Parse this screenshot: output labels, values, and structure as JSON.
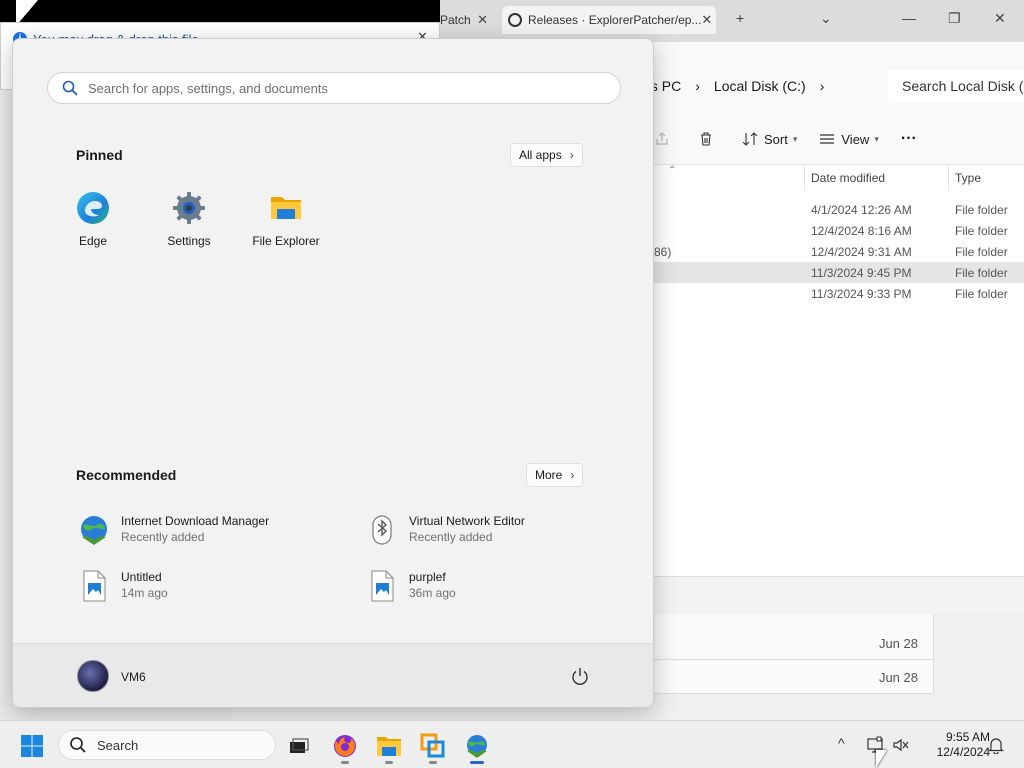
{
  "browser": {
    "tab_partial": "Patch",
    "tab_active": "Releases · ExplorerPatcher/ep...",
    "tab_close": "✕",
    "new_tab": "+",
    "dropdown": "⌄",
    "minimize": "—",
    "maximize": "❐",
    "close": "✕"
  },
  "banner": {
    "text": "You may drag & drop this file",
    "close": "✕"
  },
  "explorer": {
    "breadcrumb": [
      "his PC",
      "›",
      "Local Disk (C:)",
      "›"
    ],
    "search_placeholder": "Search Local Disk (C:)",
    "toolbar": {
      "sort": "Sort",
      "view": "View",
      "more": "···"
    },
    "columns": [
      "Date modified",
      "Type"
    ],
    "rows": [
      {
        "name": "",
        "date": "4/1/2024 12:26 AM",
        "type": "File folder",
        "selected": false
      },
      {
        "name": "",
        "date": "12/4/2024 8:16 AM",
        "type": "File folder",
        "selected": false
      },
      {
        "name": "86)",
        "date": "12/4/2024 9:31 AM",
        "type": "File folder",
        "selected": false
      },
      {
        "name": "",
        "date": "11/3/2024 9:45 PM",
        "type": "File folder",
        "selected": true
      },
      {
        "name": "",
        "date": "11/3/2024 9:33 PM",
        "type": "File folder",
        "selected": false
      }
    ]
  },
  "lower_list": [
    "Jun 28",
    "Jun 28"
  ],
  "start_menu": {
    "search_placeholder": "Search for apps, settings, and documents",
    "pinned_title": "Pinned",
    "all_apps": "All apps",
    "arrow": "›",
    "pinned": [
      {
        "label": "Edge",
        "icon": "edge-icon"
      },
      {
        "label": "Settings",
        "icon": "settings-gear-icon"
      },
      {
        "label": "File Explorer",
        "icon": "folder-icon"
      }
    ],
    "recommended_title": "Recommended",
    "more": "More",
    "recommended": [
      {
        "name": "Internet Download Manager",
        "sub": "Recently added",
        "icon": "idm-globe-icon"
      },
      {
        "name": "Virtual Network Editor",
        "sub": "Recently added",
        "icon": "bluetooth-icon"
      },
      {
        "name": "Untitled",
        "sub": "14m ago",
        "icon": "image-file-icon"
      },
      {
        "name": "purplef",
        "sub": "36m ago",
        "icon": "image-file-icon"
      }
    ],
    "user": "VM6",
    "power_icon": "power-icon"
  },
  "taskbar": {
    "search_label": "Search",
    "tray_chevron": "^",
    "time": "9:55 AM",
    "date": "12/4/2024"
  },
  "colors": {
    "accent": "#2b64c9",
    "start_bg": "#f2f2f2",
    "taskbar_bg": "#eeeeee"
  }
}
